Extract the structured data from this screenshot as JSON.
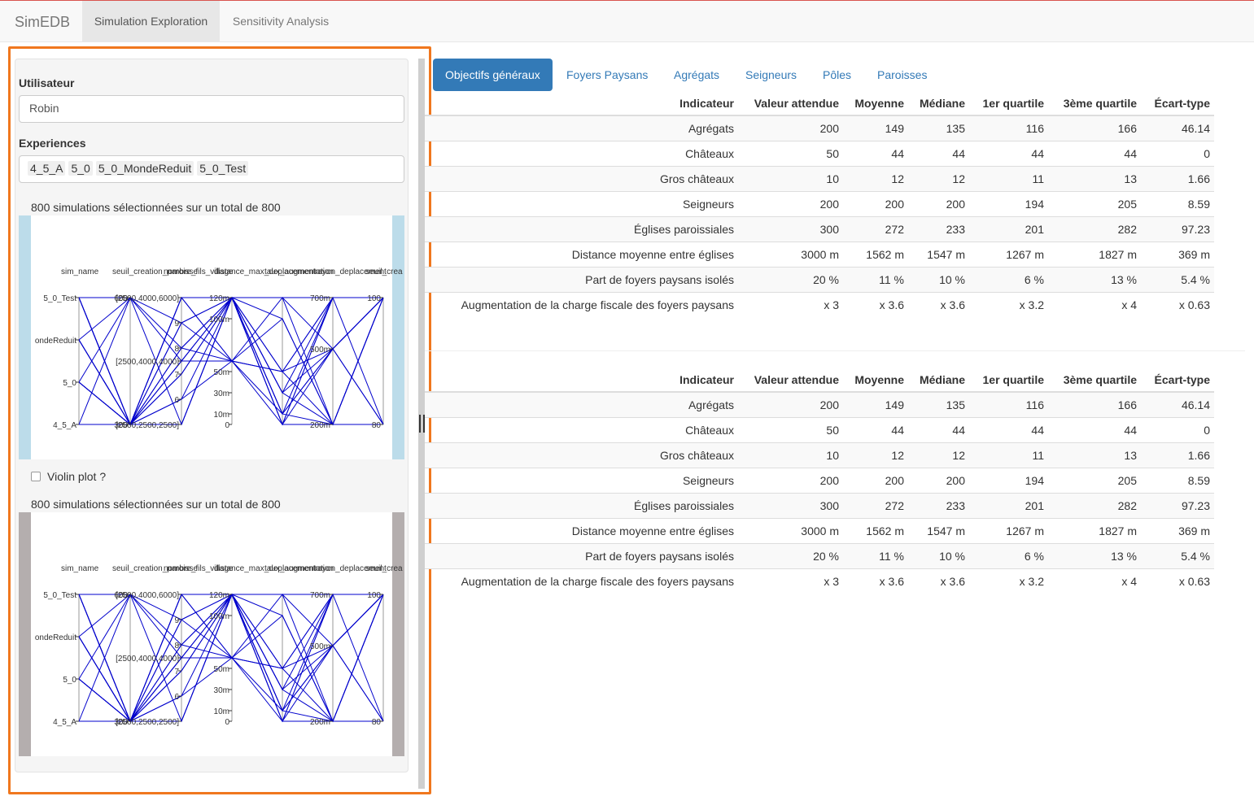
{
  "navbar": {
    "brand": "SimEDB",
    "tabs": [
      "Simulation Exploration",
      "Sensitivity Analysis"
    ]
  },
  "sidebar": {
    "user_label": "Utilisateur",
    "user_value": "Robin",
    "experiences_label": "Experiences",
    "experiences": [
      "4_5_A",
      "5_0",
      "5_0_MondeReduit",
      "5_0_Test"
    ],
    "selection_text_1": "800 simulations sélectionnées sur un total de 800",
    "violin_label": "Violin plot ?",
    "selection_text_2": "800 simulations sélectionnées sur un total de 800",
    "plot": {
      "axis_headers": [
        "sim_name",
        "seuil_creation_paroisse",
        "nombre_fils_village",
        "distance_max_deplacement",
        "taux_augmentation",
        "rayon_deplacement",
        "seuil_crea"
      ],
      "axes": [
        {
          "ticks": [
            "5_0_Test",
            "ondeReduit",
            "5_0",
            "4_5_A"
          ]
        },
        {
          "ticks": [
            "600",
            "300"
          ]
        },
        {
          "ticks": [
            "[2500,4000,6000]",
            "9",
            "8",
            "[2500,4000,4000]",
            "7",
            "6",
            "[2500,2500,2500]"
          ]
        },
        {
          "ticks": [
            "120m",
            "100m",
            "50m",
            "30m",
            "10m",
            "0"
          ]
        },
        {
          "ticks": [
            "700m",
            "500m",
            "200m"
          ]
        },
        {
          "ticks": [
            "100",
            "80"
          ]
        }
      ],
      "colors": {
        "lines": "#0000cc",
        "side_top": "#bcdcea",
        "side_bottom": "#b4aeae"
      }
    }
  },
  "main": {
    "tabs": [
      "Objectifs généraux",
      "Foyers Paysans",
      "Agrégats",
      "Seigneurs",
      "Pôles",
      "Paroisses"
    ],
    "table_headers": [
      "Indicateur",
      "Valeur attendue",
      "Moyenne",
      "Médiane",
      "1er quartile",
      "3ème quartile",
      "Écart-type"
    ],
    "table_rows": [
      [
        "Agrégats",
        "200",
        "149",
        "135",
        "116",
        "166",
        "46.14"
      ],
      [
        "Châteaux",
        "50",
        "44",
        "44",
        "44",
        "44",
        "0"
      ],
      [
        "Gros châteaux",
        "10",
        "12",
        "12",
        "11",
        "13",
        "1.66"
      ],
      [
        "Seigneurs",
        "200",
        "200",
        "200",
        "194",
        "205",
        "8.59"
      ],
      [
        "Églises paroissiales",
        "300",
        "272",
        "233",
        "201",
        "282",
        "97.23"
      ],
      [
        "Distance moyenne entre églises",
        "3000 m",
        "1562 m",
        "1547 m",
        "1267 m",
        "1827 m",
        "369 m"
      ],
      [
        "Part de foyers paysans isolés",
        "20 %",
        "11 %",
        "10 %",
        "6 %",
        "13 %",
        "5.4 %"
      ],
      [
        "Augmentation de la charge fiscale des foyers paysans",
        "x 3",
        "x 3.6",
        "x 3.6",
        "x 3.2",
        "x 4",
        "x 0.63"
      ]
    ],
    "accent": "#337ab7"
  }
}
